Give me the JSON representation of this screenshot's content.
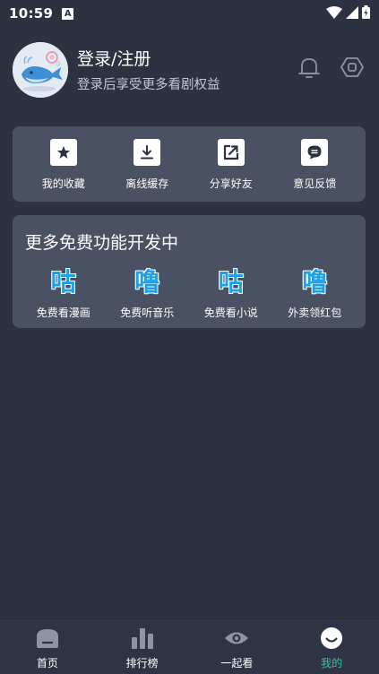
{
  "status_bar": {
    "time": "10:59",
    "notification_badge": "A"
  },
  "profile": {
    "title": "登录/注册",
    "subtitle": "登录后享受更多看剧权益"
  },
  "quick_actions": [
    {
      "label": "我的收藏",
      "icon": "star-icon"
    },
    {
      "label": "离线缓存",
      "icon": "download-icon"
    },
    {
      "label": "分享好友",
      "icon": "share-icon"
    },
    {
      "label": "意见反馈",
      "icon": "feedback-icon"
    }
  ],
  "free_features": {
    "title": "更多免费功能开发中",
    "items": [
      {
        "glyph": "咕",
        "label": "免费看漫画"
      },
      {
        "glyph": "噜",
        "label": "免费听音乐"
      },
      {
        "glyph": "咕",
        "label": "免费看小说"
      },
      {
        "glyph": "噜",
        "label": "外卖领红包"
      }
    ]
  },
  "bottom_nav": [
    {
      "label": "首页",
      "icon": "home-icon",
      "active": false
    },
    {
      "label": "排行榜",
      "icon": "bar-chart-icon",
      "active": false
    },
    {
      "label": "一起看",
      "icon": "eye-icon",
      "active": false
    },
    {
      "label": "我的",
      "icon": "smile-icon",
      "active": true
    }
  ],
  "colors": {
    "background": "#2d3240",
    "card": "#4a5163",
    "accent": "#32c7a4",
    "glyph": "#1fa0e6"
  }
}
